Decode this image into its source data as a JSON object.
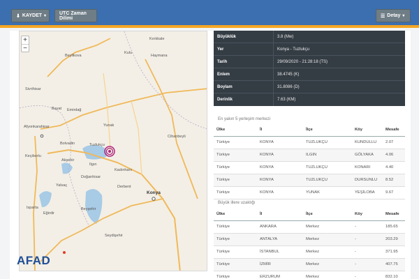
{
  "toolbar": {
    "save_label": "KAYDET",
    "utc_label": "UTC Zaman Dilimi",
    "detail_label": "Detay"
  },
  "map": {
    "places": [
      "Kulu",
      "Beylikova",
      "Haymana",
      "Sivrihisar",
      "Bayat",
      "Emirdağ",
      "Afyonkarahisar",
      "Yunak",
      "Cihanbeyli",
      "Bolvadin",
      "Tuzlukçu",
      "Akşehir",
      "Kadınhanı",
      "Doğanhisar",
      "Ilgın",
      "Derbent",
      "Konya",
      "Yalvaç",
      "Beyşehir",
      "Seydişehir",
      "Kulu",
      "Kırıkkale",
      "Keçiborlu",
      "Eğirdir",
      "Isparta"
    ],
    "logo_text": "AFAD"
  },
  "info": [
    {
      "key": "Büyüklük",
      "value": "3.8 (Mw)"
    },
    {
      "key": "Yer",
      "value": "Konya - Tuzlukçu"
    },
    {
      "key": "Tarih",
      "value": "29/09/2020 - 21:28:18 (TS)"
    },
    {
      "key": "Enlem",
      "value": "38.4745 (K)"
    },
    {
      "key": "Boylam",
      "value": "31.8086 (D)"
    },
    {
      "key": "Derinlik",
      "value": "7.63 (KM)"
    }
  ],
  "nearest_title": "En yakın 5 yerleşim merkezi",
  "nearest_headers": [
    "Ülke",
    "İl",
    "İlçe",
    "Köy",
    "Mesafe"
  ],
  "nearest_rows": [
    [
      "Türkiye",
      "KONYA",
      "TUZLUKÇU",
      "KUNDULLU",
      "2.07"
    ],
    [
      "Türkiye",
      "KONYA",
      "ILGIN",
      "GÖLYAKA",
      "4.06"
    ],
    [
      "Türkiye",
      "KONYA",
      "TUZLUKÇU",
      "KONARI",
      "4.40"
    ],
    [
      "Türkiye",
      "KONYA",
      "TUZLUKÇU",
      "DURSUNLU",
      "8.52"
    ],
    [
      "Türkiye",
      "KONYA",
      "YUNAK",
      "YEŞİLOBA",
      "9.67"
    ]
  ],
  "cities_title": "Büyük illere uzaklığı",
  "cities_headers": [
    "Ülke",
    "İl",
    "İlçe",
    "Köy",
    "Mesafe"
  ],
  "cities_rows": [
    [
      "Türkiye",
      "ANKARA",
      "Merkez",
      "-",
      "185.65"
    ],
    [
      "Türkiye",
      "ANTALYA",
      "Merkez",
      "-",
      "203.29"
    ],
    [
      "Türkiye",
      "İSTANBUL",
      "Merkez",
      "-",
      "371.95"
    ],
    [
      "Türkiye",
      "İZMİR",
      "Merkez",
      "-",
      "407.75"
    ],
    [
      "Türkiye",
      "ERZURUM",
      "Merkez",
      "-",
      "832.10"
    ]
  ]
}
